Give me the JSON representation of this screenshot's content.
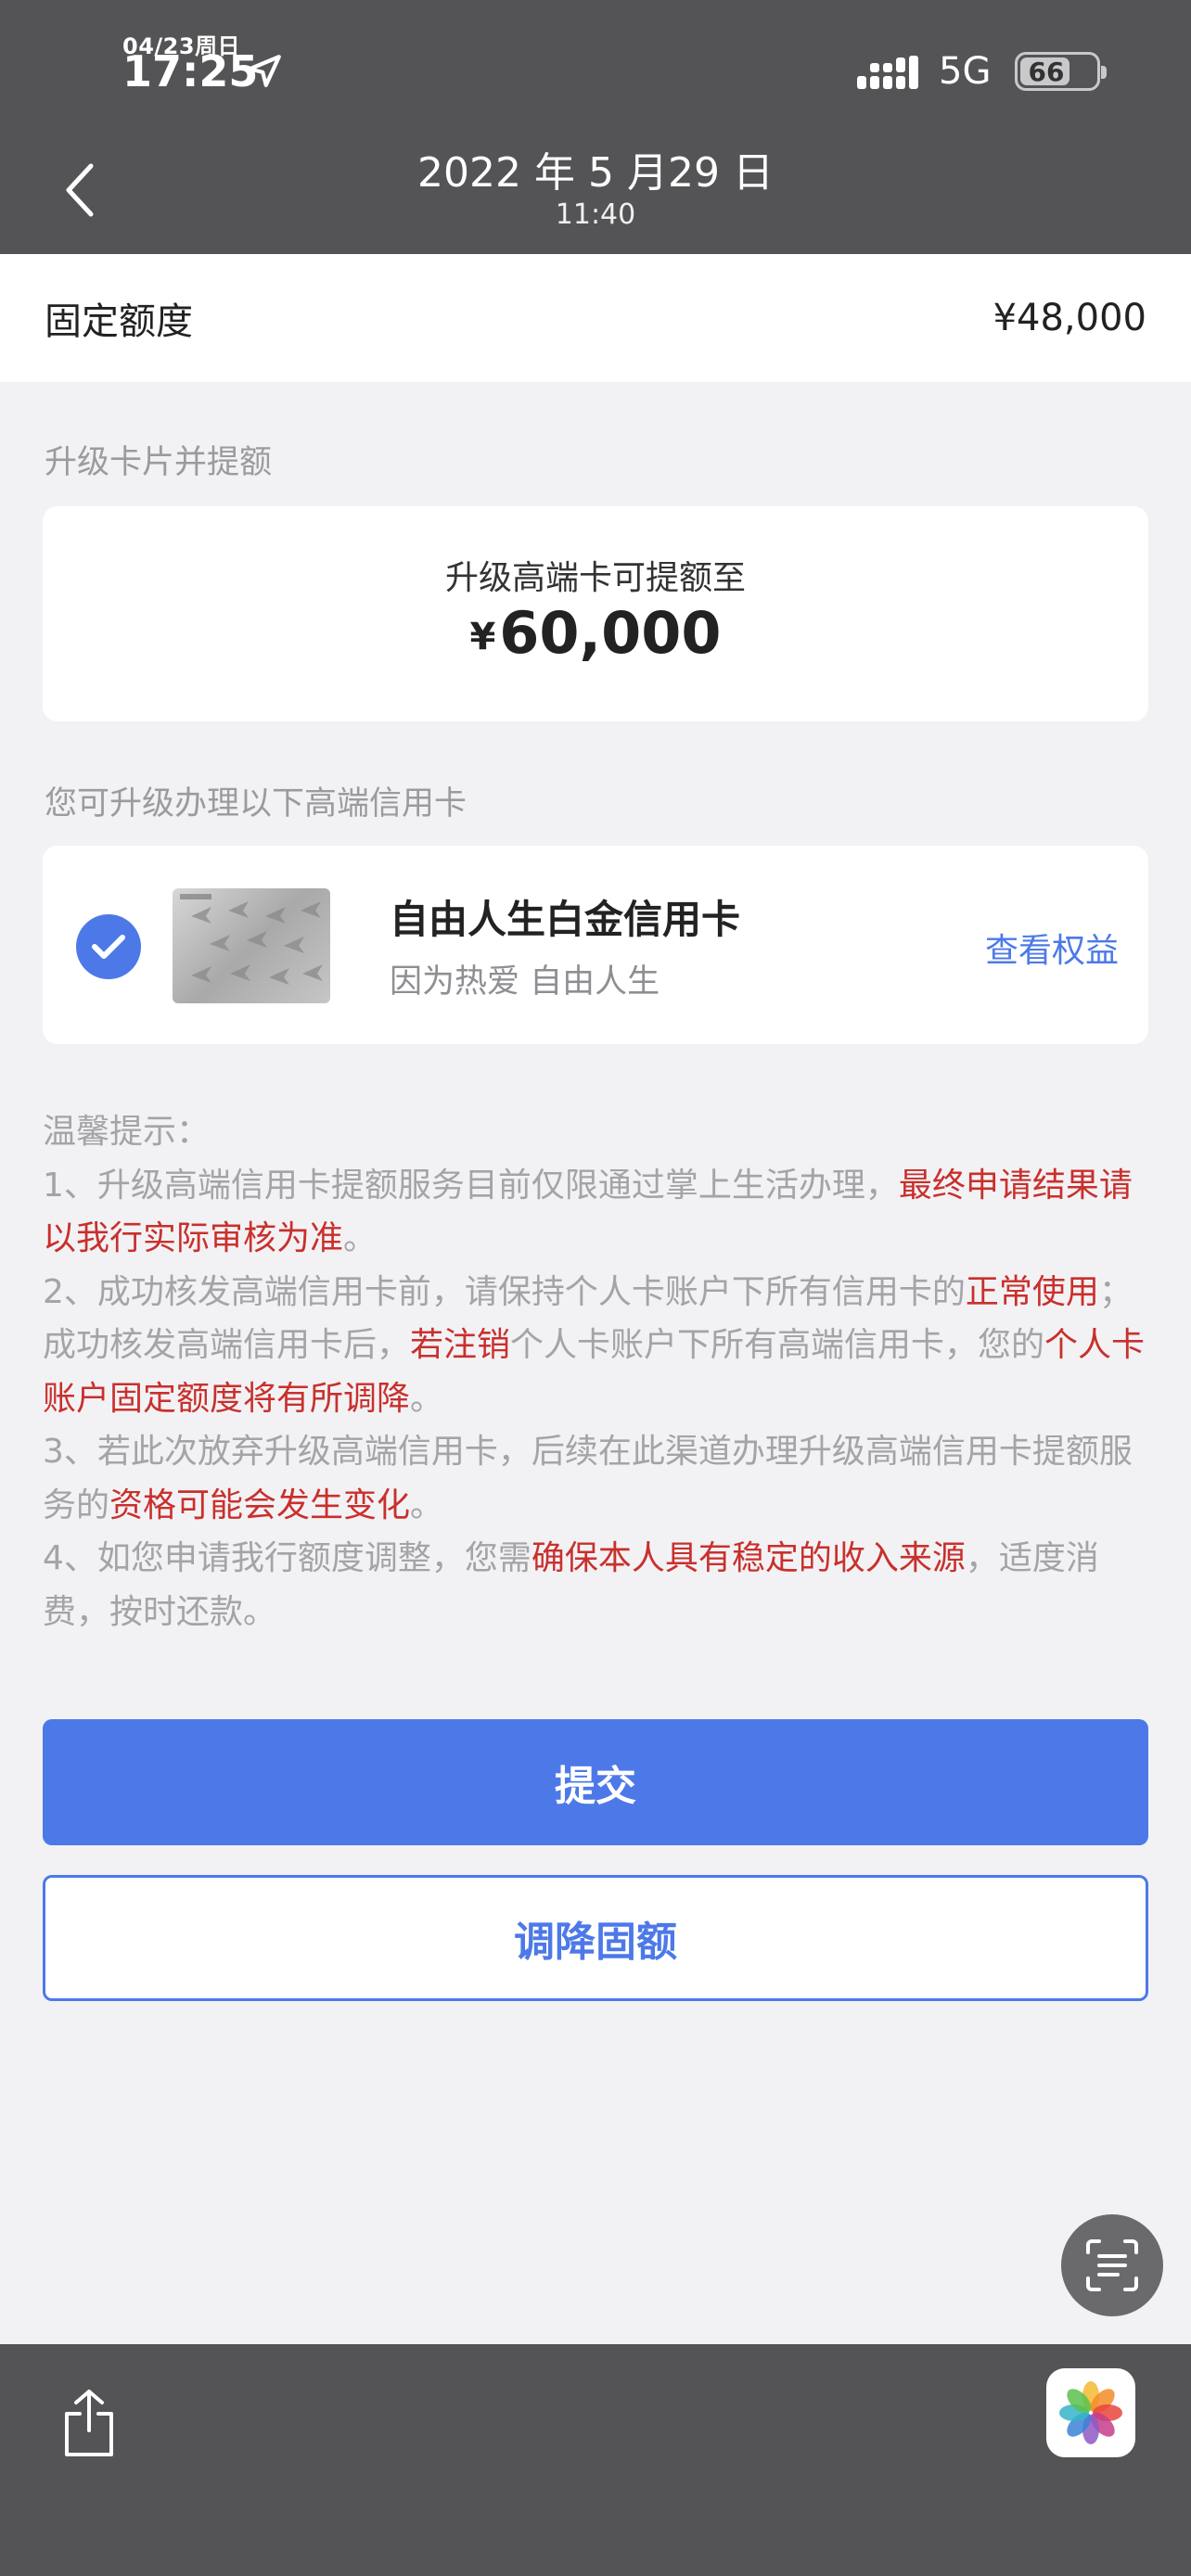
{
  "status_bar": {
    "date": "04/23周日",
    "time": "17:25",
    "network": "5G",
    "battery": "66",
    "battery_level_percent": 66
  },
  "header": {
    "title_date": "2022 年 5 月29 日",
    "title_time": "11:40"
  },
  "fixed_quota": {
    "label": "固定额度",
    "value": "¥48,000"
  },
  "upgrade_section": {
    "title": "升级卡片并提额",
    "card_text": "升级高端卡可提额至",
    "currency": "¥",
    "amount": "60,000"
  },
  "card_section": {
    "title": "您可升级办理以下高端信用卡",
    "card_name": "自由人生白金信用卡",
    "card_slogan": "因为热爱 自由人生",
    "benefits_link": "查看权益"
  },
  "notice": {
    "title": "温馨提示：",
    "p1_a": "1、升级高端信用卡提额服务目前仅限通过掌上生活办理，",
    "p1_b": "最终申请结果请以我行实际审核为准",
    "p1_c": "。",
    "p2_a": "2、成功核发高端信用卡前，请保持个人卡账户下所有信用卡的",
    "p2_b": "正常使用",
    "p2_c": "；成功核发高端信用卡后，",
    "p2_d": "若注销",
    "p2_e": "个人卡账户下所有高端信用卡，您的",
    "p2_f": "个人卡账户固定额度将有所调降",
    "p2_g": "。",
    "p3_a": "3、若此次放弃升级高端信用卡，后续在此渠道办理升级高端信用卡提额服务的",
    "p3_b": "资格可能会发生变化",
    "p3_c": "。",
    "p4_a": "4、如您申请我行额度调整，您需",
    "p4_b": "确保本人具有稳定的收入来源",
    "p4_c": "，适度消费，按时还款。"
  },
  "buttons": {
    "submit": "提交",
    "reduce_quota": "调降固额"
  },
  "icons": {
    "back": "chevron-left-icon",
    "location": "location-arrow-icon",
    "signal": "signal-bars-icon",
    "scan": "text-scan-icon",
    "share": "share-icon",
    "photos": "photos-app-icon"
  },
  "colors": {
    "accent": "#4d79e8",
    "highlight_red": "#c9302c",
    "muted_text": "#a3a3a8"
  }
}
